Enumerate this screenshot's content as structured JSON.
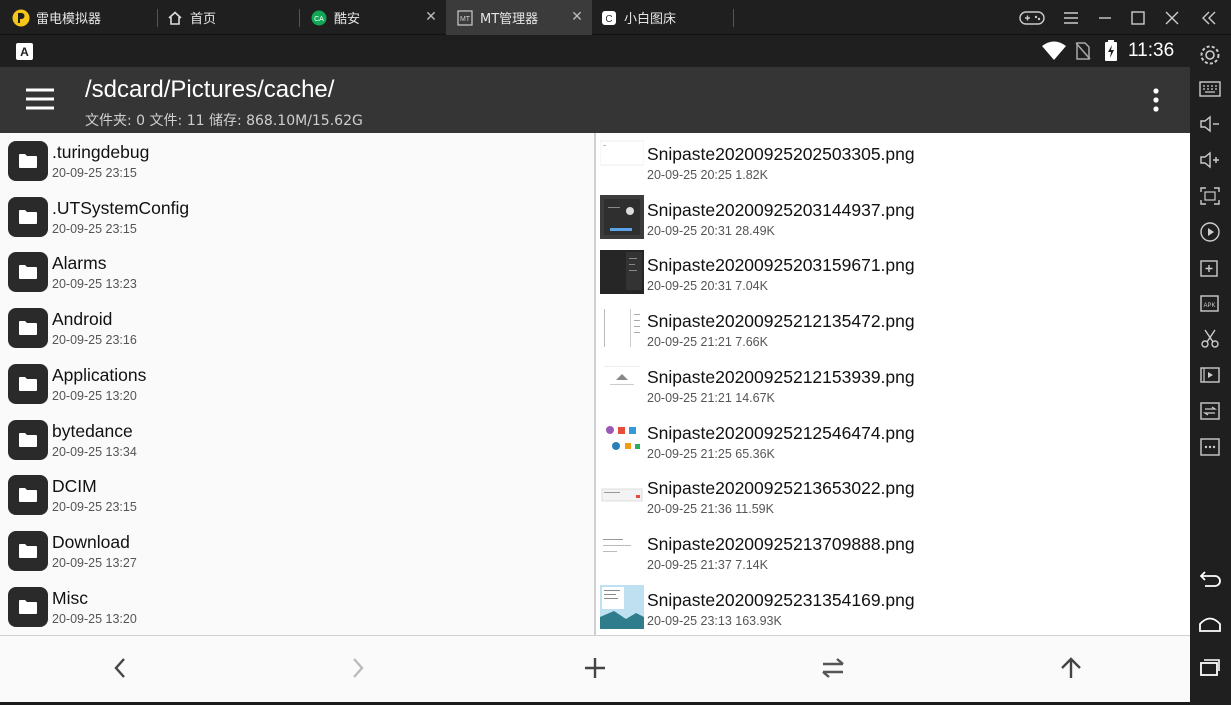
{
  "tabs": [
    {
      "label": "雷电模拟器",
      "icon": "ldplayer-logo-icon"
    },
    {
      "label": "首页",
      "icon": "home-icon"
    },
    {
      "label": "酷安",
      "icon": "coolapk-icon"
    },
    {
      "label": "MT管理器",
      "icon": "mt-manager-icon",
      "active": true
    },
    {
      "label": "小白图床",
      "icon": "image-host-icon"
    }
  ],
  "status": {
    "time": "11:36",
    "notification_icon": "a-icon"
  },
  "appbar": {
    "path": "/sdcard/Pictures/cache/",
    "summary": "文件夹: 0  文件: 11  储存: 868.10M/15.62G"
  },
  "left_list": [
    {
      "name": ".turingdebug",
      "date": "20-09-25 23:15"
    },
    {
      "name": ".UTSystemConfig",
      "date": "20-09-25 23:15"
    },
    {
      "name": "Alarms",
      "date": "20-09-25 13:23"
    },
    {
      "name": "Android",
      "date": "20-09-25 23:16"
    },
    {
      "name": "Applications",
      "date": "20-09-25 13:20"
    },
    {
      "name": "bytedance",
      "date": "20-09-25 13:34"
    },
    {
      "name": "DCIM",
      "date": "20-09-25 23:15"
    },
    {
      "name": "Download",
      "date": "20-09-25 13:27"
    },
    {
      "name": "Misc",
      "date": "20-09-25 13:20"
    }
  ],
  "right_list": [
    {
      "name": "Snipaste20200925202503305.png",
      "meta": "20-09-25 20:25  1.82K",
      "thumb": "white"
    },
    {
      "name": "Snipaste20200925203144937.png",
      "meta": "20-09-25 20:31  28.49K",
      "thumb": "dark-ui"
    },
    {
      "name": "Snipaste20200925203159671.png",
      "meta": "20-09-25 20:31  7.04K",
      "thumb": "dark"
    },
    {
      "name": "Snipaste20200925212135472.png",
      "meta": "20-09-25 21:21  7.66K",
      "thumb": "list"
    },
    {
      "name": "Snipaste20200925212153939.png",
      "meta": "20-09-25 21:21  14.67K",
      "thumb": "cloud"
    },
    {
      "name": "Snipaste20200925212546474.png",
      "meta": "20-09-25 21:25  65.36K",
      "thumb": "icons"
    },
    {
      "name": "Snipaste20200925213653022.png",
      "meta": "20-09-25 21:36  11.59K",
      "thumb": "dialog"
    },
    {
      "name": "Snipaste20200925213709888.png",
      "meta": "20-09-25 21:37  7.14K",
      "thumb": "text"
    },
    {
      "name": "Snipaste20200925231354169.png",
      "meta": "20-09-25 23:13  163.93K",
      "thumb": "landscape"
    }
  ],
  "icons": {
    "menu": "hamburger-menu-icon",
    "more": "more-vert-icon",
    "back": "chevron-left-icon",
    "forward": "chevron-right-icon",
    "add": "plus-icon",
    "swap": "swap-icon",
    "up": "arrow-up-icon"
  },
  "colors": {
    "appbar": "#353535",
    "statusbar": "#1f1f1f",
    "folder": "#2a2a2a",
    "accent": "#f5c518"
  }
}
